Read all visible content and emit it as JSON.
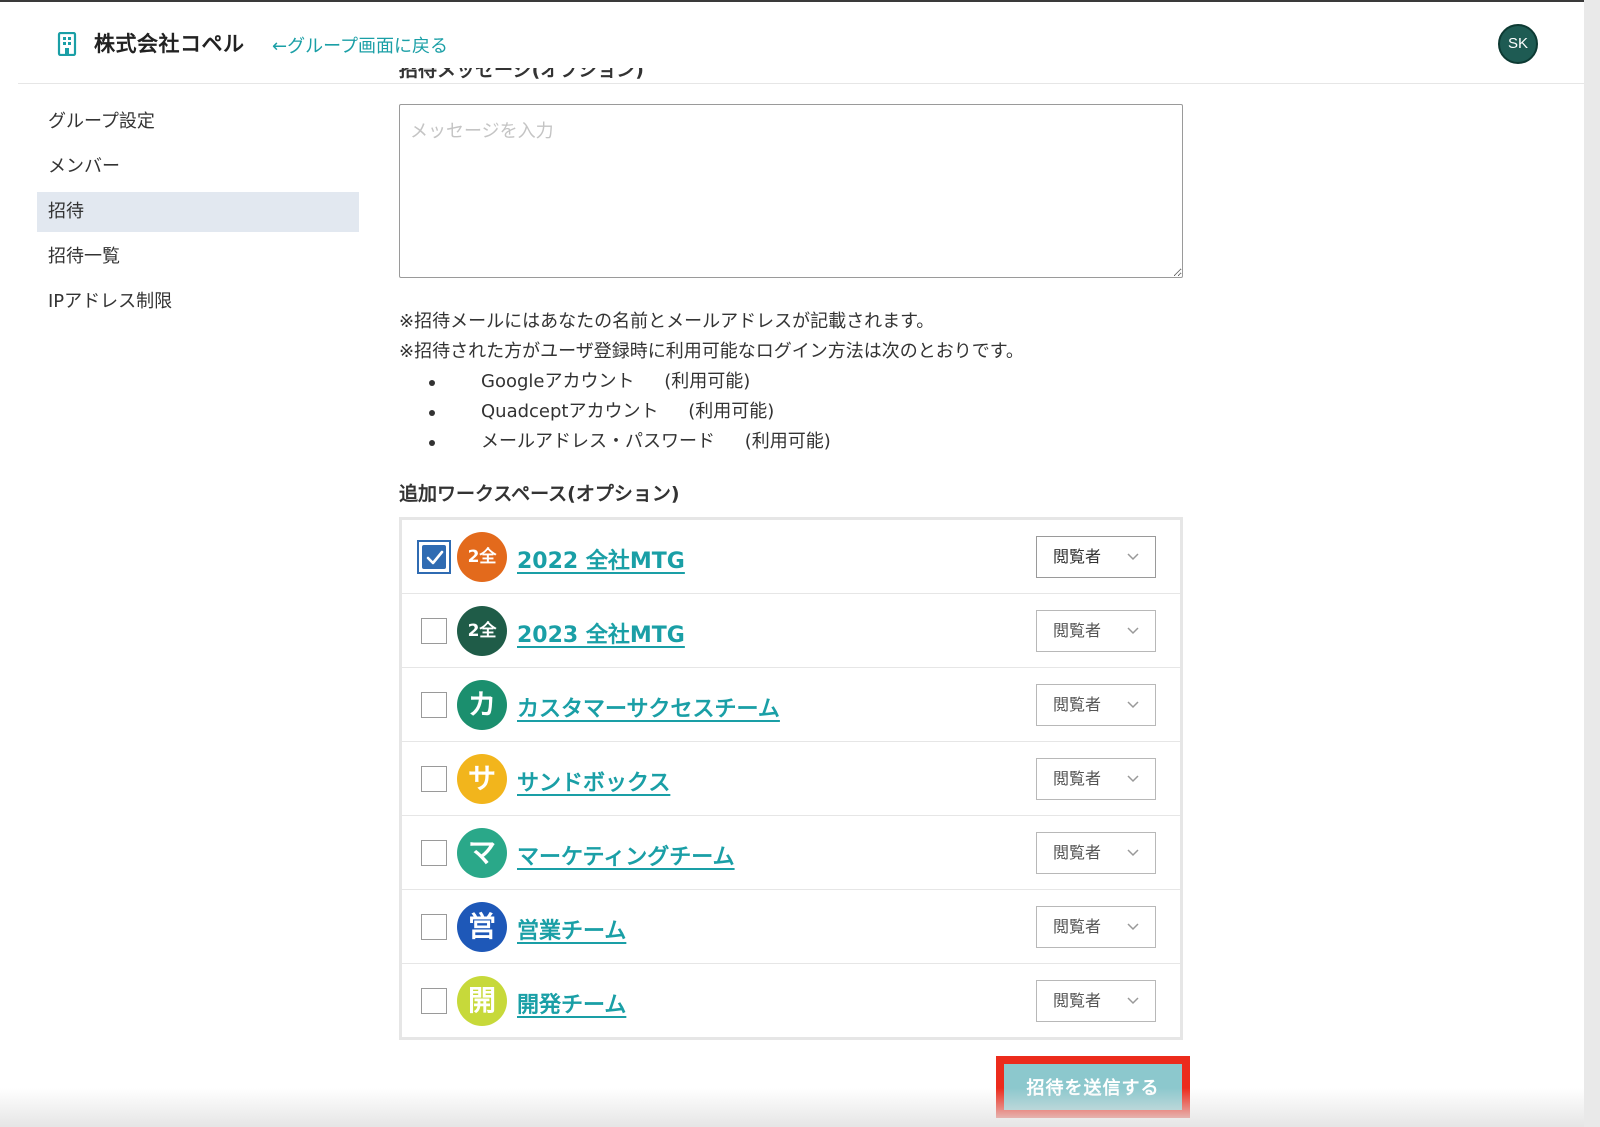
{
  "header": {
    "company_name": "株式会社コペル",
    "back_link": "←グループ画面に戻る",
    "avatar_initials": "SK"
  },
  "sidebar": {
    "items": [
      {
        "label": "グループ設定"
      },
      {
        "label": "メンバー"
      },
      {
        "label": "招待",
        "active": true
      },
      {
        "label": "招待一覧"
      },
      {
        "label": "IPアドレス制限"
      }
    ]
  },
  "message": {
    "label_cut": "招待メッセージ(オプション)",
    "placeholder": "メッセージを入力",
    "value": ""
  },
  "notes": {
    "line1": "※招待メールにはあなたの名前とメールアドレスが記載されます。",
    "line2": "※招待された方がユーザ登録時に利用可能なログイン方法は次のとおりです。",
    "methods": [
      {
        "name": "Googleアカウント",
        "status": "(利用可能)"
      },
      {
        "name": "Quadceptアカウント",
        "status": "(利用可能)"
      },
      {
        "name": "メールアドレス・パスワード",
        "status": "(利用可能)"
      }
    ]
  },
  "workspaces": {
    "heading": "追加ワークスペース(オプション)",
    "items": [
      {
        "name": "2022 全社MTG",
        "icon_text": "2全",
        "color": "#e36a1c",
        "checked": true,
        "role": "閲覧者"
      },
      {
        "name": "2023 全社MTG",
        "icon_text": "2全",
        "color": "#1f5c48",
        "checked": false,
        "role": "閲覧者"
      },
      {
        "name": "カスタマーサクセスチーム",
        "icon_text": "カ",
        "color": "#1b8f6e",
        "checked": false,
        "role": "閲覧者"
      },
      {
        "name": "サンドボックス",
        "icon_text": "サ",
        "color": "#f2b51c",
        "checked": false,
        "role": "閲覧者"
      },
      {
        "name": "マーケティングチーム",
        "icon_text": "マ",
        "color": "#2aa889",
        "checked": false,
        "role": "閲覧者"
      },
      {
        "name": "営業チーム",
        "icon_text": "営",
        "color": "#1e58b8",
        "checked": false,
        "role": "閲覧者"
      },
      {
        "name": "開発チーム",
        "icon_text": "開",
        "color": "#c7d93a",
        "checked": false,
        "role": "閲覧者"
      }
    ]
  },
  "submit": {
    "label": "招待を送信する"
  },
  "icons": {
    "building": "building-icon",
    "check": "check-icon",
    "chevron": "chevron-down-icon"
  }
}
